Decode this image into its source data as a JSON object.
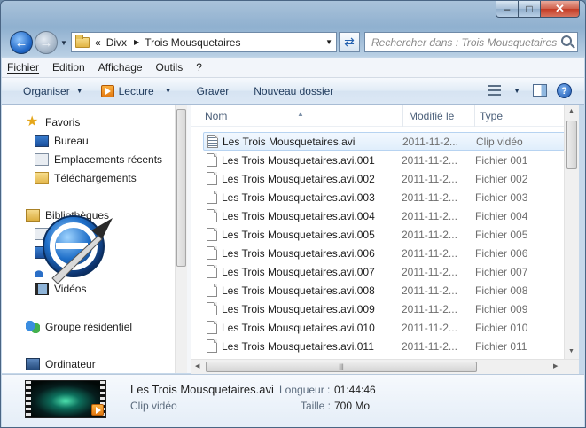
{
  "window": {
    "caption_minimize": "–",
    "caption_maximize": "□",
    "caption_close": "✕"
  },
  "address": {
    "prefix": "«",
    "crumbs": [
      "Divx",
      "Trois Mousquetaires"
    ],
    "search_placeholder": "Rechercher dans : Trois Mousquetaires"
  },
  "menu": [
    "Fichier",
    "Edition",
    "Affichage",
    "Outils",
    "?"
  ],
  "toolbar": {
    "organize": "Organiser",
    "play": "Lecture",
    "burn": "Graver",
    "new_folder": "Nouveau dossier",
    "help": "?"
  },
  "nav": {
    "favorites": "Favoris",
    "desktop": "Bureau",
    "recent": "Emplacements récents",
    "downloads": "Téléchargements",
    "libraries": "Bibliothèques",
    "videos": "Vidéos",
    "homegroup": "Groupe résidentiel",
    "computer": "Ordinateur"
  },
  "columns": {
    "name": "Nom",
    "modified": "Modifié le",
    "type": "Type"
  },
  "files": [
    {
      "name": "Les Trois Mousquetaires.avi",
      "date": "2011-11-2...",
      "type": "Clip vidéo"
    },
    {
      "name": "Les Trois Mousquetaires.avi.001",
      "date": "2011-11-2...",
      "type": "Fichier 001"
    },
    {
      "name": "Les Trois Mousquetaires.avi.002",
      "date": "2011-11-2...",
      "type": "Fichier 002"
    },
    {
      "name": "Les Trois Mousquetaires.avi.003",
      "date": "2011-11-2...",
      "type": "Fichier 003"
    },
    {
      "name": "Les Trois Mousquetaires.avi.004",
      "date": "2011-11-2...",
      "type": "Fichier 004"
    },
    {
      "name": "Les Trois Mousquetaires.avi.005",
      "date": "2011-11-2...",
      "type": "Fichier 005"
    },
    {
      "name": "Les Trois Mousquetaires.avi.006",
      "date": "2011-11-2...",
      "type": "Fichier 006"
    },
    {
      "name": "Les Trois Mousquetaires.avi.007",
      "date": "2011-11-2...",
      "type": "Fichier 007"
    },
    {
      "name": "Les Trois Mousquetaires.avi.008",
      "date": "2011-11-2...",
      "type": "Fichier 008"
    },
    {
      "name": "Les Trois Mousquetaires.avi.009",
      "date": "2011-11-2...",
      "type": "Fichier 009"
    },
    {
      "name": "Les Trois Mousquetaires.avi.010",
      "date": "2011-11-2...",
      "type": "Fichier 010"
    },
    {
      "name": "Les Trois Mousquetaires.avi.011",
      "date": "2011-11-2...",
      "type": "Fichier 011"
    }
  ],
  "details": {
    "filename": "Les Trois Mousquetaires.avi",
    "filetype": "Clip vidéo",
    "length_label": "Longueur :",
    "length_value": "01:44:46",
    "size_label": "Taille :",
    "size_value": "700 Mo"
  },
  "colors": {
    "accent": "#1e395b",
    "selection": "#e0eefc"
  }
}
